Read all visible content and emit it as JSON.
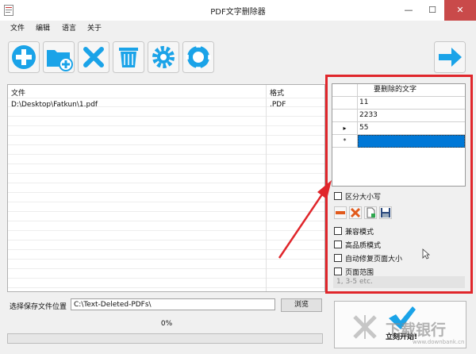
{
  "window": {
    "title": "PDF文字删除器",
    "minimize_glyph": "—",
    "maximize_glyph": "☐",
    "close_glyph": "✕"
  },
  "menu": [
    "文件",
    "编辑",
    "语言",
    "关于"
  ],
  "toolbar": [
    {
      "icon": "add-icon"
    },
    {
      "icon": "add-folder-icon"
    },
    {
      "icon": "remove-icon"
    },
    {
      "icon": "trash-icon"
    },
    {
      "icon": "gear-icon"
    },
    {
      "icon": "lifebuoy-icon"
    },
    {
      "icon": "arrow-right-icon"
    }
  ],
  "file_list": {
    "columns": [
      "文件",
      "格式"
    ],
    "rows": [
      {
        "file": "D:\\Desktop\\Fatkun\\1.pdf",
        "format": ".PDF"
      }
    ]
  },
  "words_grid": {
    "header": "要删除的文字",
    "rows": [
      {
        "marker": "",
        "value": "11"
      },
      {
        "marker": "",
        "value": "2233"
      },
      {
        "marker": "▸",
        "value": "55"
      },
      {
        "marker": "*",
        "value": ""
      }
    ]
  },
  "options": {
    "case_sensitive": "区分大小写",
    "compat_mode": "兼容模式",
    "high_quality": "高品质模式",
    "auto_fix_page_size": "自动修复页面大小",
    "page_range": "页面范围",
    "page_range_placeholder": "1, 3-5 etc."
  },
  "save": {
    "label": "选择保存文件位置",
    "path": "C:\\Text-Deleted-PDFs\\",
    "browse": "浏览"
  },
  "progress": {
    "text": "0%",
    "value": 0
  },
  "start_button": {
    "label": "立刻开始!"
  },
  "watermark": {
    "text": "下载银行",
    "url": "www.downbank.cn"
  },
  "colors": {
    "accent": "#0078d7",
    "highlight_frame": "#e0262b",
    "icon_blue": "#1aa3e8"
  }
}
